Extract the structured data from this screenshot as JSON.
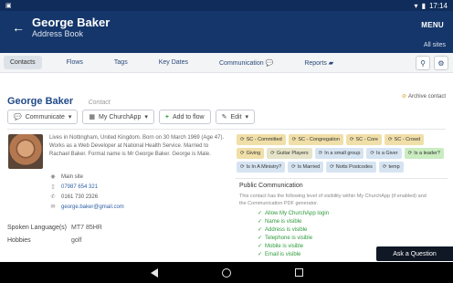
{
  "status_bar": {
    "time": "17:14",
    "left_icon": "sim-icon"
  },
  "header": {
    "title": "George Baker",
    "subtitle": "Address Book",
    "menu_label": "MENU",
    "sites_label": "All sites"
  },
  "tabs": [
    {
      "label": "Contacts",
      "active": true
    },
    {
      "label": "Flows",
      "active": false
    },
    {
      "label": "Tags",
      "active": false
    },
    {
      "label": "Key Dates",
      "active": false
    },
    {
      "label": "Communication",
      "active": false
    },
    {
      "label": "Reports",
      "active": false
    }
  ],
  "contact": {
    "name": "George Baker",
    "type": "Contact",
    "archive_label": "Archive contact",
    "actions": {
      "communicate": "Communicate",
      "churchapp": "My ChurchApp",
      "add_to_flow": "Add to flow",
      "edit": "Edit"
    },
    "about": "Lives in Nottingham, United Kingdom. Born on 30 March 1969 (Age 47). Works as a Web Developer at National Health Service. Married to Rachael Baker. Formal name is Mr George Baker. George is Male.",
    "site": "Main site",
    "mobile": "07987 654 321",
    "phone": "0161 730 2326",
    "email": "george.baker@gmail.com",
    "fields": [
      {
        "label": "Spoken Language(s)",
        "value": "MT7 85HR"
      },
      {
        "label": "Hobbies",
        "value": "golf"
      }
    ]
  },
  "tags": [
    {
      "label": "SC - Committed",
      "color": "#f0dfa8"
    },
    {
      "label": "SC - Congregation",
      "color": "#f0dfa8"
    },
    {
      "label": "SC - Core",
      "color": "#f0dfa8"
    },
    {
      "label": "SC - Crowd",
      "color": "#f0dfa8"
    },
    {
      "label": "Giving",
      "color": "#f0dfa8"
    },
    {
      "label": "Guitar Players",
      "color": "#e6e4c8"
    },
    {
      "label": "In a small group",
      "color": "#d6e4f2"
    },
    {
      "label": "Is a Giver",
      "color": "#d6e4f2"
    },
    {
      "label": "Is a leader?",
      "color": "#c9ecc0"
    },
    {
      "label": "Is In A Ministry?",
      "color": "#d6e4f2"
    },
    {
      "label": "Is Married",
      "color": "#d6e4f2"
    },
    {
      "label": "Notts Postcodes",
      "color": "#d6e4f2"
    },
    {
      "label": "temp",
      "color": "#d6e4f2"
    }
  ],
  "public_communication": {
    "title": "Public Communication",
    "description": "This contact has the following level of visibility within My ChurchApp (if enabled) and the Communication PDF generator.",
    "items": [
      "Allow My ChurchApp login",
      "Name is visible",
      "Address is visible",
      "Telephone is visible",
      "Mobile is visible",
      "Email is visible"
    ]
  },
  "ask_question": "Ask a Question"
}
